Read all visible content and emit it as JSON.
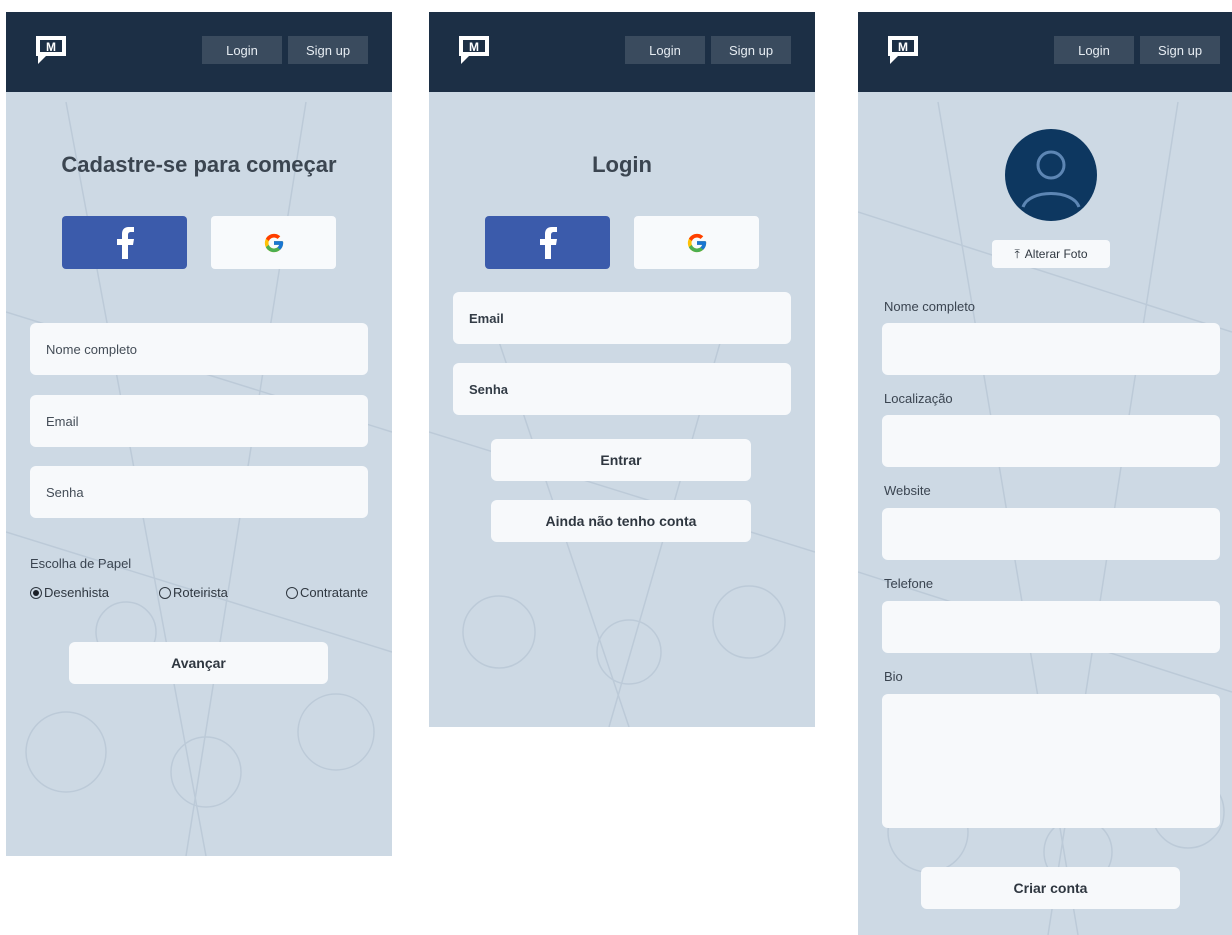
{
  "colors": {
    "navbar": "#1c2f45",
    "nav_button": "#3a4b5e",
    "screen_bg": "#cdd9e4",
    "facebook": "#3b5bab",
    "avatar": "#0d3760"
  },
  "nav": {
    "login_label": "Login",
    "signup_label": "Sign up"
  },
  "signup": {
    "title": "Cadastre-se para começar",
    "facebook_icon": "facebook-icon",
    "google_icon": "google-icon",
    "name_placeholder": "Nome completo",
    "email_placeholder": "Email",
    "password_placeholder": "Senha",
    "role_label": "Escolha de Papel",
    "roles": [
      {
        "label": "Desenhista",
        "selected": true
      },
      {
        "label": "Roteirista",
        "selected": false
      },
      {
        "label": "Contratante",
        "selected": false
      }
    ],
    "next_label": "Avançar"
  },
  "login": {
    "title": "Login",
    "email_placeholder": "Email",
    "password_placeholder": "Senha",
    "enter_label": "Entrar",
    "no_account_label": "Ainda não tenho conta"
  },
  "profile": {
    "change_photo_label": "Alterar Foto",
    "fields": {
      "name": "Nome completo",
      "location": "Localização",
      "website": "Website",
      "phone": "Telefone",
      "bio": "Bio"
    },
    "create_account_label": "Criar conta"
  }
}
